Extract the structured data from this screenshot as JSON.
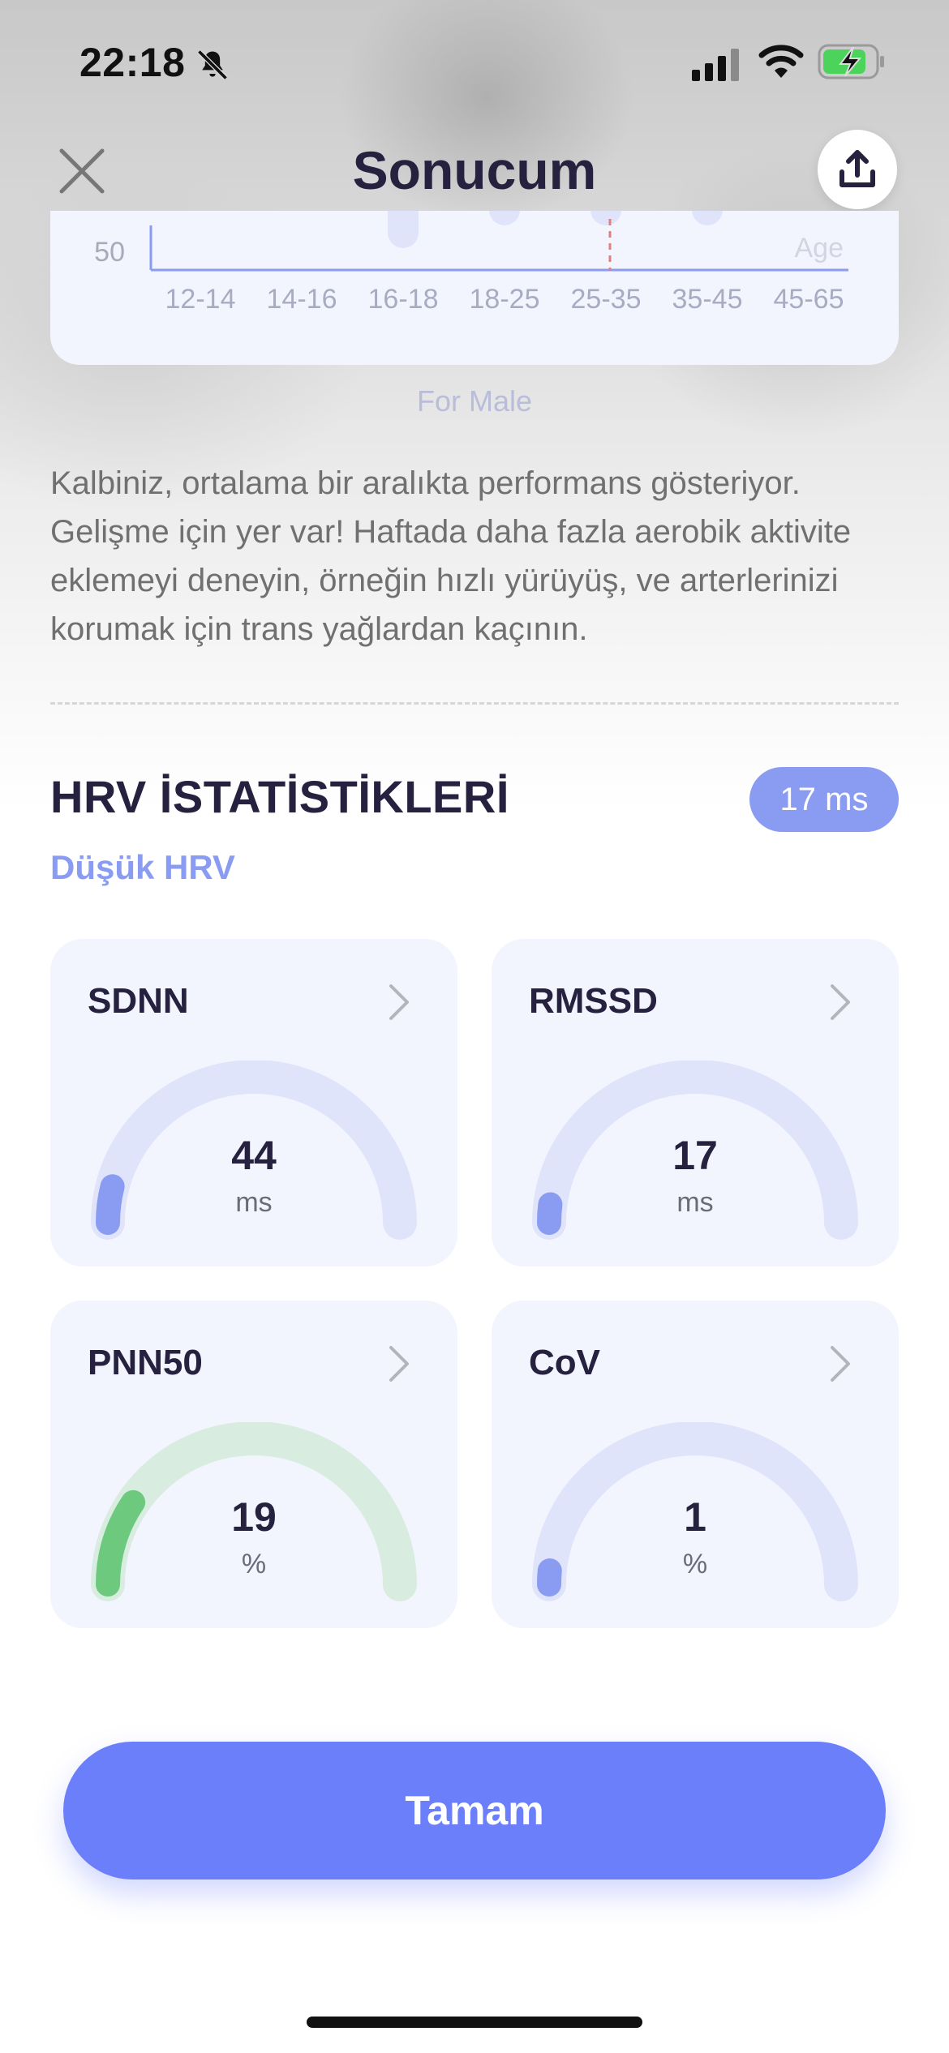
{
  "status_bar": {
    "time": "22:18",
    "icons": [
      "bell-off-icon",
      "signal-icon",
      "wifi-icon",
      "battery-charging-icon"
    ]
  },
  "header": {
    "title": "Sonucum",
    "close_icon": "close-icon",
    "share_icon": "share-icon"
  },
  "age_chart": {
    "y_tick": "50",
    "x_axis_label": "Age",
    "x_ticks": [
      "12-14",
      "14-16",
      "16-18",
      "18-25",
      "25-35",
      "35-45",
      "45-65"
    ],
    "caption": "For Male",
    "accent_color": "#6b7ffb",
    "marker_color": "#e08080"
  },
  "description": "Kalbiniz, ortalama bir aralıkta performans gösteriyor. Gelişme için yer var! Haftada daha fazla aerobik aktivite eklemeyi deneyin, örneğin hızlı yürüyüş, ve arterlerinizi korumak için trans yağlardan kaçının.",
  "hrv": {
    "title": "HRV İSTATİSTİKLERİ",
    "badge": "17 ms",
    "status": "Düşük HRV",
    "stats": [
      {
        "name": "SDNN",
        "value": "44",
        "unit": "ms",
        "level": 0.08,
        "track_color": "#dfe4fb",
        "fill_color": "#8a9cf2"
      },
      {
        "name": "RMSSD",
        "value": "17",
        "unit": "ms",
        "level": 0.04,
        "track_color": "#dfe4fb",
        "fill_color": "#8a9cf2"
      },
      {
        "name": "PNN50",
        "value": "19",
        "unit": "%",
        "level": 0.19,
        "track_color": "#d8ecdf",
        "fill_color": "#6cc97e"
      },
      {
        "name": "CoV",
        "value": "1",
        "unit": "%",
        "level": 0.03,
        "track_color": "#dfe4fb",
        "fill_color": "#8a9cf2"
      }
    ]
  },
  "cta": {
    "label": "Tamam",
    "color": "#6b7ffb"
  }
}
